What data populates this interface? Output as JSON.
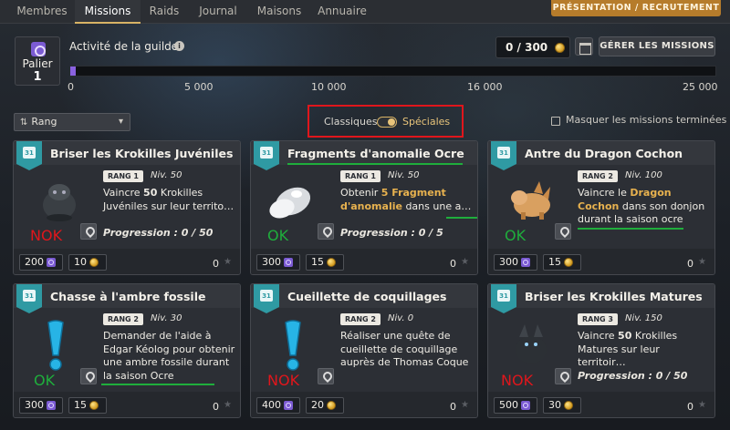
{
  "tabs": [
    {
      "label": "Membres",
      "active": false
    },
    {
      "label": "Missions",
      "active": true
    },
    {
      "label": "Raids",
      "active": false
    },
    {
      "label": "Journal",
      "active": false
    },
    {
      "label": "Maisons",
      "active": false
    },
    {
      "label": "Annuaire",
      "active": false
    }
  ],
  "header": {
    "presentation_button": "PRÉSENTATION / RECRUTEMENT",
    "palier_label": "Palier",
    "palier_value": "1",
    "activity_label": "Activité de la guilde",
    "activity_info_icon": "info-icon",
    "score": "0 / 300",
    "manage_button": "GÉRER LES MISSIONS",
    "progress_fraction": 0.0,
    "ticks": [
      "0",
      "5 000",
      "10 000",
      "16 000",
      "25 000"
    ]
  },
  "filters": {
    "sort_label": "Rang",
    "toggle_left": "Classiques",
    "toggle_right": "Spéciales",
    "toggle_state": "Spéciales",
    "hide_finished_label": "Masquer les missions terminées",
    "hide_finished_checked": false
  },
  "colors": {
    "accent_gold": "#d8b365",
    "badge_teal": "#2f9aa3",
    "ok_green": "#1fae3c",
    "nok_red": "#e0161c",
    "gem_purple": "#7b5bd3"
  },
  "cards": [
    {
      "title": "Briser les Krokilles Juvéniles",
      "rank": "RANG 1",
      "level": "Niv. 50",
      "desc_pre": "Vaincre ",
      "desc_bold": "50",
      "desc_post": " Krokilles Juvéniles sur leur territo…",
      "progress": "Progression : 0 / 50",
      "status": "NOK",
      "reward_gems": "200",
      "reward_coins": "10",
      "extra": "0"
    },
    {
      "title": "Fragments d'anomalie Ocre",
      "rank": "RANG 1",
      "level": "Niv. 50",
      "desc_pre": "Obtenir ",
      "desc_bold": "5 Fragment d'anomalie",
      "desc_post": " dans une a…",
      "progress": "Progression : 0 / 5",
      "status": "OK",
      "reward_gems": "300",
      "reward_coins": "15",
      "extra": "0"
    },
    {
      "title": "Antre du Dragon Cochon",
      "rank": "RANG 2",
      "level": "Niv. 100",
      "desc_pre": "Vaincre le ",
      "desc_bold": "Dragon Cochon",
      "desc_post": " dans son donjon durant la saison ocre",
      "progress": "",
      "status": "OK",
      "reward_gems": "300",
      "reward_coins": "15",
      "extra": "0"
    },
    {
      "title": "Chasse à l'ambre fossile",
      "rank": "RANG 2",
      "level": "Niv. 30",
      "desc_pre": "Demander de l'aide à Edgar Kéolog pour obtenir une ambre fossile durant la saison Ocre",
      "desc_bold": "",
      "desc_post": "",
      "progress": "",
      "status": "OK",
      "reward_gems": "300",
      "reward_coins": "15",
      "extra": "0"
    },
    {
      "title": "Cueillette de coquillages",
      "rank": "RANG 2",
      "level": "Niv. 0",
      "desc_pre": "Réaliser une quête de cueillette de coquillage auprès de Thomas Coque",
      "desc_bold": "",
      "desc_post": "",
      "progress": "",
      "status": "NOK",
      "reward_gems": "400",
      "reward_coins": "20",
      "extra": "0"
    },
    {
      "title": "Briser les Krokilles Matures",
      "rank": "RANG 3",
      "level": "Niv. 150",
      "desc_pre": "Vaincre ",
      "desc_bold": "50",
      "desc_post": " Krokilles Matures sur leur territoir…",
      "progress": "Progression : 0 / 50",
      "status": "NOK",
      "reward_gems": "500",
      "reward_coins": "30",
      "extra": "0"
    }
  ]
}
